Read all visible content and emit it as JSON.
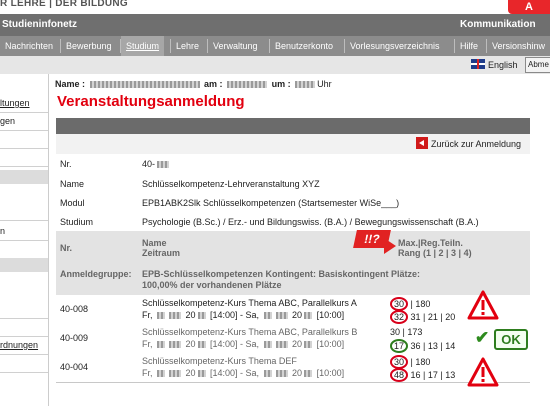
{
  "header": {
    "brand": "R LEHRE | DER BILDUNG",
    "logo_text": "A",
    "portal_title": "Studieninfonetz",
    "kommunikation": "Kommunikation"
  },
  "nav": {
    "items": [
      "Nachrichten",
      "Bewerbung",
      "Studium",
      "Lehre",
      "Verwaltung",
      "Benutzerkonto",
      "Vorlesungsverzeichnis",
      "Hilfe",
      "Versionshinw"
    ],
    "active": "Studium"
  },
  "lang": {
    "label": "English",
    "logout": "Abme"
  },
  "sidebar": {
    "items": [
      "ltungen",
      "gen",
      "",
      "",
      "",
      "n",
      "",
      "",
      "rdnungen",
      ""
    ]
  },
  "name_line": {
    "name_label": "Name :",
    "am_label": "am :",
    "um_label": "um :",
    "uhr": "Uhr"
  },
  "page_title": "Veranstaltungsanmeldung",
  "back_label": "Zurück zur Anmeldung",
  "info": {
    "nr_label": "Nr.",
    "nr_value": "40-",
    "name_label": "Name",
    "name_value": "Schlüsselkompetenz-Lehrveranstaltung XYZ",
    "modul_label": "Modul",
    "modul_value": "EPB1ABK2Slk Schlüsselkompetenzen (Startsemester WiSe___)",
    "studium_label": "Studium",
    "studium_value": "Psychologie (B.Sc.) / Erz.- und Bildungswiss. (B.A.) / Bewegungswissenschaft (B.A.)"
  },
  "table_header": {
    "nr": "Nr.",
    "name": "Name",
    "zeitraum": "Zeitraum",
    "max": "Max.|Reg.Teiln.",
    "rang": "Rang (1 | 2 | 3 | 4)"
  },
  "annotation_flag": "!!?",
  "group": {
    "label": "Anmeldegruppe:",
    "line1": "EPB-Schlüsselkompetenzen Kontingent: Basiskontingent Plätze:",
    "line2": "100,00% der vorhandenen  Plätze"
  },
  "courses": [
    {
      "nr": "40-008",
      "title": "Schlüsselkompetenz-Kurs Thema ABC, Parallelkurs A",
      "time_a": "Fr, ",
      "time_b": " 20",
      "time_c": " [14:00] - Sa, ",
      "time_d": " 20",
      "time_e": " [10:00]",
      "max": "30",
      "reg": "180",
      "rank_first": "32",
      "rank_rest": "31 | 21 | 20"
    },
    {
      "nr": "40-009",
      "title": "Schlüsselkompetenz-Kurs Thema ABC, Parallelkurs B",
      "time_a": "Fr, ",
      "time_b": " 20",
      "time_c": " [14:00] - Sa, ",
      "time_d": " 20",
      "time_e": " [10:00]",
      "max": "30",
      "reg": "173",
      "rank_first": "17",
      "rank_rest": "36 | 13 | 14"
    },
    {
      "nr": "40-004",
      "title": "Schlüsselkompetenz-Kurs Thema DEF",
      "time_a": "Fr, ",
      "time_b": " 20",
      "time_c": " [14:00] - Sa, ",
      "time_d": " 20",
      "time_e": " [10:00]",
      "max": "30",
      "reg": "180",
      "rank_first": "48",
      "rank_rest": "16 | 17 | 13"
    }
  ],
  "ok_label": "OK",
  "colors": {
    "accent_red": "#e2000f",
    "ok_green": "#2e7d1e",
    "nav_gray": "#8c8c8c"
  }
}
